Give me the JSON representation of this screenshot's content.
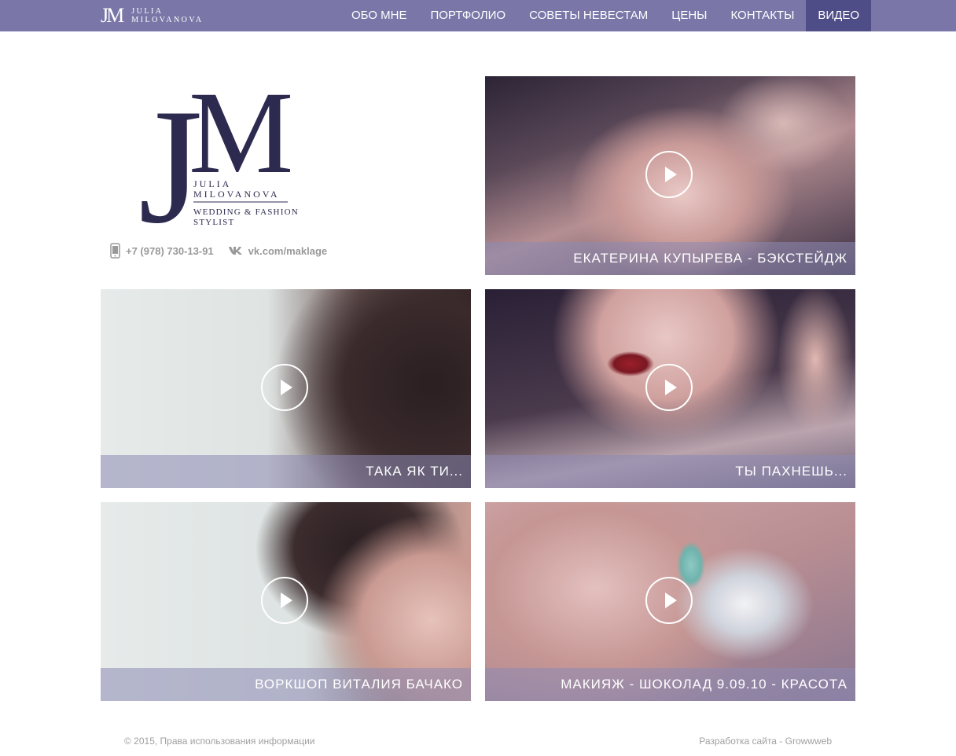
{
  "brand": {
    "mark": "JM",
    "name_line1": "JULIA",
    "name_line2": "MILOVANOVA"
  },
  "nav": [
    {
      "label": "ОБО МНЕ"
    },
    {
      "label": "ПОРТФОЛИО"
    },
    {
      "label": "СОВЕТЫ НЕВЕСТАМ"
    },
    {
      "label": "ЦЕНЫ"
    },
    {
      "label": "КОНТАКТЫ"
    },
    {
      "label": "ВИДЕО",
      "active": true
    }
  ],
  "logo": {
    "mark_j": "J",
    "mark_m": "M",
    "name_line1": "JULIA",
    "name_line2": "MILOVANOVA",
    "tagline_line1": "WEDDING & FASHION",
    "tagline_line2": "STYLIST"
  },
  "contacts": {
    "phone": "+7 (978) 730-13-91",
    "vk": "vk.com/maklage",
    "phone_icon": "mobile-phone-icon",
    "vk_icon": "vk-icon"
  },
  "videos": [
    {
      "title": "ЕКАТЕРИНА КУПЫРЕВА - БЭКСТЕЙДЖ"
    },
    {
      "title": "ТАКА ЯК ТИ..."
    },
    {
      "title": "ТЫ ПАХНЕШЬ..."
    },
    {
      "title": "ВОРКШОП ВИТАЛИЯ БАЧАКО"
    },
    {
      "title": "МАКИЯЖ - ШОКОЛАД 9.09.10 - КРАСОТА"
    }
  ],
  "footer": {
    "copyright": "© 2015, Права использования информации",
    "developer": "Разработка сайта - Growwweb"
  },
  "colors": {
    "nav_bg": "#7a77a8",
    "nav_active": "#4f4d87",
    "logo_ink": "#2d2a4f"
  }
}
